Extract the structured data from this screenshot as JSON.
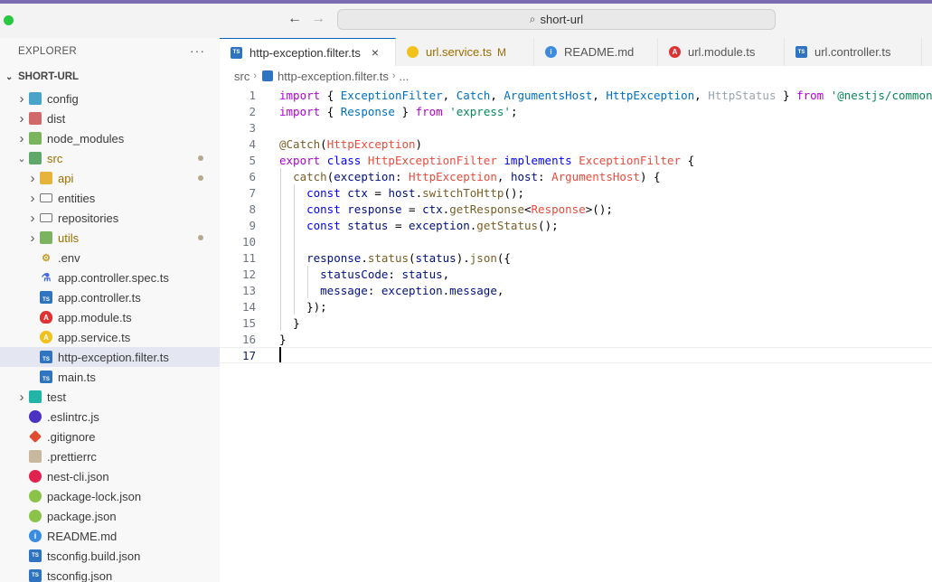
{
  "titlebar": {
    "search_text": "short-url",
    "back_arrow": "←",
    "forward_arrow": "→"
  },
  "sidebar": {
    "title": "EXPLORER",
    "more": "···",
    "root_label": "SHORT-URL",
    "items": [
      {
        "label": "config",
        "icon": "folder-config-icon",
        "chevron": "right",
        "indent": 1,
        "modified": false
      },
      {
        "label": "dist",
        "icon": "folder-dist-icon",
        "chevron": "right",
        "indent": 1,
        "modified": false
      },
      {
        "label": "node_modules",
        "icon": "folder-node-icon",
        "chevron": "right",
        "indent": 1,
        "modified": false
      },
      {
        "label": "src",
        "icon": "folder-src-icon",
        "chevron": "down",
        "indent": 1,
        "modified": true
      },
      {
        "label": "api",
        "icon": "folder-api-icon",
        "chevron": "right",
        "indent": 2,
        "modified": true
      },
      {
        "label": "entities",
        "icon": "folder-icon",
        "chevron": "right",
        "indent": 2,
        "modified": false
      },
      {
        "label": "repositories",
        "icon": "folder-icon",
        "chevron": "right",
        "indent": 2,
        "modified": false
      },
      {
        "label": "utils",
        "icon": "folder-utils-icon",
        "chevron": "right",
        "indent": 2,
        "modified": true
      },
      {
        "label": ".env",
        "icon": "env-icon",
        "chevron": "",
        "indent": 2,
        "modified": false
      },
      {
        "label": "app.controller.spec.ts",
        "icon": "test-icon",
        "chevron": "",
        "indent": 2,
        "modified": false
      },
      {
        "label": "app.controller.ts",
        "icon": "typescript-icon",
        "chevron": "",
        "indent": 2,
        "modified": false
      },
      {
        "label": "app.module.ts",
        "icon": "angular-icon",
        "chevron": "",
        "indent": 2,
        "modified": false
      },
      {
        "label": "app.service.ts",
        "icon": "service-icon",
        "chevron": "",
        "indent": 2,
        "modified": false
      },
      {
        "label": "http-exception.filter.ts",
        "icon": "typescript-icon",
        "chevron": "",
        "indent": 2,
        "modified": false,
        "active": true
      },
      {
        "label": "main.ts",
        "icon": "typescript-icon",
        "chevron": "",
        "indent": 2,
        "modified": false
      },
      {
        "label": "test",
        "icon": "folder-test-icon",
        "chevron": "right",
        "indent": 1,
        "modified": false
      },
      {
        "label": ".eslintrc.js",
        "icon": "eslint-icon",
        "chevron": "",
        "indent": 1,
        "modified": false
      },
      {
        "label": ".gitignore",
        "icon": "git-icon",
        "chevron": "",
        "indent": 1,
        "modified": false
      },
      {
        "label": ".prettierrc",
        "icon": "prettier-icon",
        "chevron": "",
        "indent": 1,
        "modified": false
      },
      {
        "label": "nest-cli.json",
        "icon": "nest-icon",
        "chevron": "",
        "indent": 1,
        "modified": false
      },
      {
        "label": "package-lock.json",
        "icon": "json-icon",
        "chevron": "",
        "indent": 1,
        "modified": false
      },
      {
        "label": "package.json",
        "icon": "json-icon",
        "chevron": "",
        "indent": 1,
        "modified": false
      },
      {
        "label": "README.md",
        "icon": "info-icon",
        "chevron": "",
        "indent": 1,
        "modified": false
      },
      {
        "label": "tsconfig.build.json",
        "icon": "tsconfig-icon",
        "chevron": "",
        "indent": 1,
        "modified": false
      },
      {
        "label": "tsconfig.json",
        "icon": "tsconfig-icon",
        "chevron": "",
        "indent": 1,
        "modified": false
      }
    ]
  },
  "tabs": [
    {
      "label": "http-exception.filter.ts",
      "icon": "typescript-icon",
      "active": true,
      "close": "×"
    },
    {
      "label": "url.service.ts",
      "icon": "service-icon",
      "modified_marker": "M"
    },
    {
      "label": "README.md",
      "icon": "info-icon"
    },
    {
      "label": "url.module.ts",
      "icon": "angular-icon"
    },
    {
      "label": "url.controller.ts",
      "icon": "typescript-icon"
    }
  ],
  "breadcrumb": {
    "folder": "src",
    "file": "http-exception.filter.ts",
    "ellipsis": "..."
  },
  "editor": {
    "line_numbers": [
      "1",
      "2",
      "3",
      "4",
      "5",
      "6",
      "7",
      "8",
      "9",
      "10",
      "11",
      "12",
      "13",
      "14",
      "15",
      "16",
      "17"
    ],
    "current_line": 17,
    "lines": [
      "import { ExceptionFilter, Catch, ArgumentsHost, HttpException, HttpStatus } from '@nestjs/common';",
      "import { Response } from 'express';",
      "",
      "@Catch(HttpException)",
      "export class HttpExceptionFilter implements ExceptionFilter {",
      "  catch(exception: HttpException, host: ArgumentsHost) {",
      "    const ctx = host.switchToHttp();",
      "    const response = ctx.getResponse<Response>();",
      "    const status = exception.getStatus();",
      "",
      "    response.status(status).json({",
      "      statusCode: status,",
      "      message: exception.message,",
      "    });",
      "  }",
      "}",
      ""
    ]
  },
  "colors": {
    "accent": "#005fb8",
    "titlebar_top": "#7b6bb0",
    "active_row": "#e4e6f1",
    "modified": "#9b6e00"
  }
}
